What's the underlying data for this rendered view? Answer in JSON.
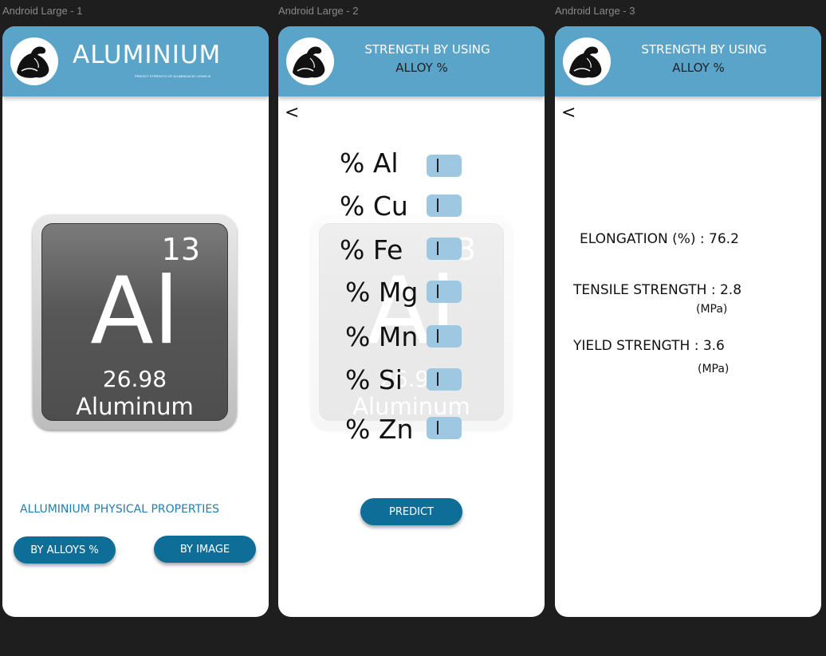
{
  "frames": [
    {
      "label": "Android Large - 1"
    },
    {
      "label": "Android Large - 2"
    },
    {
      "label": "Android Large - 3"
    }
  ],
  "home": {
    "title": "ALUMINIUM",
    "subtitle": "PREDICT STRENGTH OF ALUMINIUM BY USING AI",
    "element": {
      "atomic_number": "13",
      "symbol": "Al",
      "mass": "26.98",
      "name": "Aluminum"
    },
    "properties_label": "ALLUMINIUM PHYSICAL PROPERTIES",
    "btn_alloys": "BY ALLOYS %",
    "btn_image": "BY IMAGE"
  },
  "alloy": {
    "header_line1": "STRENGTH BY USING",
    "header_line2": "ALLOY %",
    "back": "<",
    "rows": [
      {
        "label": "% Al"
      },
      {
        "label": "% Cu"
      },
      {
        "label": "% Fe"
      },
      {
        "label": "% Mg"
      },
      {
        "label": "% Mn"
      },
      {
        "label": "% Si"
      },
      {
        "label": "% Zn"
      }
    ],
    "predict": "PREDICT"
  },
  "result": {
    "header_line1": "STRENGTH BY USING",
    "header_line2": "ALLOY %",
    "back": "<",
    "elongation": "ELONGATION  (%)   : 76.2",
    "tensile": "TENSILE STRENGTH : 2.8",
    "tensile_unit": "(MPa)",
    "yield": "YIELD STRENGTH      : 3.6",
    "yield_unit": "(MPa)"
  },
  "colors": {
    "header": "#5aa3c9",
    "button": "#0f6e98",
    "field": "#9ec8e2"
  }
}
